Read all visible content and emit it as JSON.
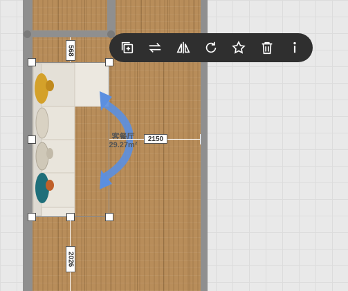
{
  "canvas": {
    "room_name": "客餐厅",
    "room_area": "29.27m²",
    "dimensions": {
      "top_vertical": "568",
      "bottom_vertical": "2026",
      "horizontal": "2150"
    }
  },
  "toolbar": {
    "buttons": [
      {
        "name": "copy-add",
        "icon": "copy-add-icon"
      },
      {
        "name": "swap",
        "icon": "swap-arrows-icon"
      },
      {
        "name": "mirror",
        "icon": "mirror-icon"
      },
      {
        "name": "rotate",
        "icon": "rotate-icon"
      },
      {
        "name": "favorite",
        "icon": "star-icon"
      },
      {
        "name": "delete",
        "icon": "trash-icon"
      },
      {
        "name": "info",
        "icon": "info-icon"
      }
    ]
  },
  "colors": {
    "wood": "#b88d5a",
    "wall": "#8f8f8f",
    "toolbar_bg": "#2f2f2f",
    "rotate_arrow": "#5b8fe0",
    "cushion_yellow": "#d4a12a",
    "cushion_teal": "#1f6f7a"
  }
}
